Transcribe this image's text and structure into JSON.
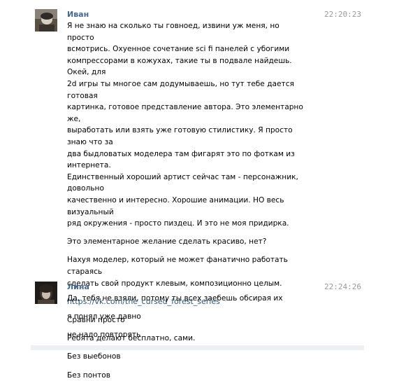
{
  "messages": [
    {
      "author": "Иван",
      "time": "22:20:23",
      "avatar_icon": "user-avatar-photo",
      "paragraphs": [
        "Я не знаю на сколько ты говноед, извини уж меня, но просто\nвсмотрись. Охуенное сочетание sci fi панелей с убогими\nкомпрессорами в кожухах, такие ты в подвале найдешь. Окей, для\n2d игры ты многое сам додумываешь, но тут тебе дается готовая\nкартинка, готовое представление автора. Это элементарно же,\nвыработать или взять уже готовую стилистику. Я просто знаю что за\nдва быдловатых моделера там фигарят это по фоткам из интернета.\nЕдинственный хороший артист сейчас там - персонажник, довольно\nкачественно и интересно. Хорошие анимации. НО весь визуальный\nряд окружения - просто пиздец. И это не моя придирка.",
        "Это элементарное желание сделать красиво, нет?",
        "Нахуя моделер, который не может фанатично работать стараясь\nсделать свой продукт клевым, композиционно целым."
      ],
      "link": "https://vk.com/the_cursed_forest_series",
      "after_link": [
        "Сравни просто",
        "Ребята делают бесплатно, сами.",
        "Без выебонов",
        "Без понтов"
      ]
    },
    {
      "author": "Лина",
      "time": "22:24:26",
      "avatar_icon": "user-avatar-photo",
      "paragraphs": [
        "Да, тебя не взяли, потому ты всех заебешь обсирая их",
        "я понял уже давно",
        "не надо повторять"
      ]
    }
  ],
  "colors": {
    "author": "#45688e",
    "time": "#999999",
    "link": "#2b587a",
    "footer": "#edf0f5"
  }
}
